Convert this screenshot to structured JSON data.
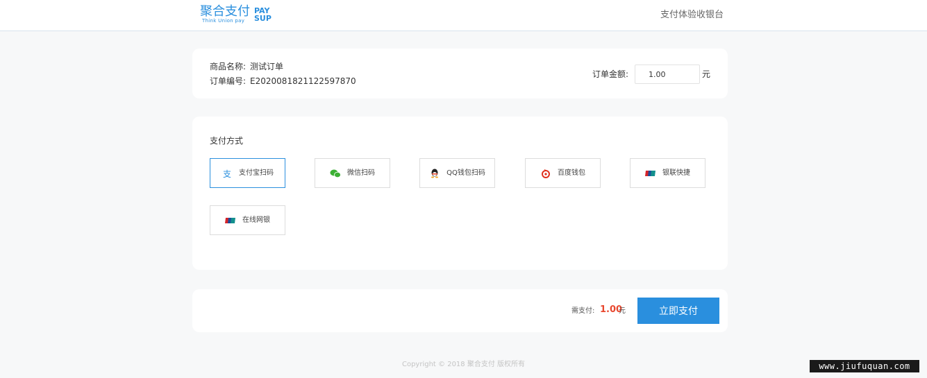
{
  "header": {
    "logo_cn": "聚合支付",
    "logo_en_sub": "Think Union pay",
    "logo_pay": "PAY",
    "logo_sup": "SUP",
    "title": "支付体验收银台"
  },
  "order": {
    "name_label": "商品名称:",
    "name_value": "测试订单",
    "number_label": "订单编号:",
    "number_value": "E2020081821122597870",
    "amount_label": "订单金额:",
    "amount_value": "1.00",
    "amount_unit": "元"
  },
  "payment": {
    "title": "支付方式",
    "methods": [
      {
        "label": "支付宝扫码",
        "icon": "alipay-icon",
        "selected": true
      },
      {
        "label": "微信扫码",
        "icon": "wechat-icon",
        "selected": false
      },
      {
        "label": "QQ钱包扫码",
        "icon": "qq-icon",
        "selected": false
      },
      {
        "label": "百度钱包",
        "icon": "baidu-wallet-icon",
        "selected": false
      },
      {
        "label": "银联快捷",
        "icon": "unionpay-icon",
        "selected": false
      },
      {
        "label": "在线网银",
        "icon": "unionpay-icon",
        "selected": false
      }
    ]
  },
  "submit": {
    "need_label": "需支付:",
    "need_amount": "1.00",
    "need_unit": "元",
    "button_label": "立即支付"
  },
  "footer": {
    "copyright": "Copyright © 2018 聚合支付 版权所有"
  },
  "watermark": "www.jiufuquan.com",
  "colors": {
    "accent": "#2a8fde",
    "price": "#e8482f",
    "background": "#f7f8f9"
  }
}
